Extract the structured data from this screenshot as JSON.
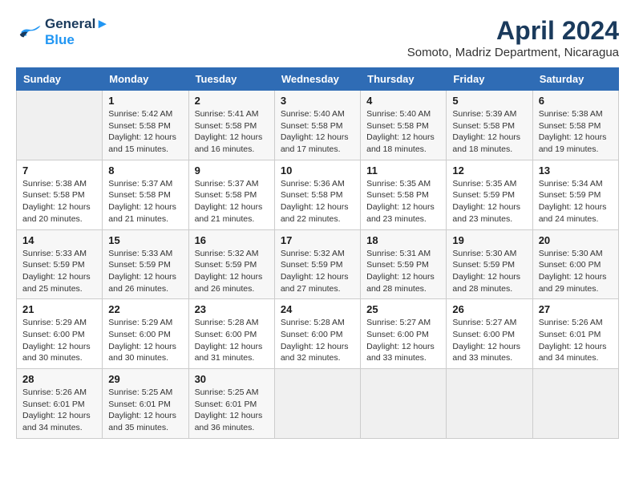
{
  "logo": {
    "line1": "General",
    "line2": "Blue"
  },
  "title": "April 2024",
  "subtitle": "Somoto, Madriz Department, Nicaragua",
  "days_header": [
    "Sunday",
    "Monday",
    "Tuesday",
    "Wednesday",
    "Thursday",
    "Friday",
    "Saturday"
  ],
  "weeks": [
    [
      {
        "num": "",
        "info": ""
      },
      {
        "num": "1",
        "info": "Sunrise: 5:42 AM\nSunset: 5:58 PM\nDaylight: 12 hours\nand 15 minutes."
      },
      {
        "num": "2",
        "info": "Sunrise: 5:41 AM\nSunset: 5:58 PM\nDaylight: 12 hours\nand 16 minutes."
      },
      {
        "num": "3",
        "info": "Sunrise: 5:40 AM\nSunset: 5:58 PM\nDaylight: 12 hours\nand 17 minutes."
      },
      {
        "num": "4",
        "info": "Sunrise: 5:40 AM\nSunset: 5:58 PM\nDaylight: 12 hours\nand 18 minutes."
      },
      {
        "num": "5",
        "info": "Sunrise: 5:39 AM\nSunset: 5:58 PM\nDaylight: 12 hours\nand 18 minutes."
      },
      {
        "num": "6",
        "info": "Sunrise: 5:38 AM\nSunset: 5:58 PM\nDaylight: 12 hours\nand 19 minutes."
      }
    ],
    [
      {
        "num": "7",
        "info": "Sunrise: 5:38 AM\nSunset: 5:58 PM\nDaylight: 12 hours\nand 20 minutes."
      },
      {
        "num": "8",
        "info": "Sunrise: 5:37 AM\nSunset: 5:58 PM\nDaylight: 12 hours\nand 21 minutes."
      },
      {
        "num": "9",
        "info": "Sunrise: 5:37 AM\nSunset: 5:58 PM\nDaylight: 12 hours\nand 21 minutes."
      },
      {
        "num": "10",
        "info": "Sunrise: 5:36 AM\nSunset: 5:58 PM\nDaylight: 12 hours\nand 22 minutes."
      },
      {
        "num": "11",
        "info": "Sunrise: 5:35 AM\nSunset: 5:58 PM\nDaylight: 12 hours\nand 23 minutes."
      },
      {
        "num": "12",
        "info": "Sunrise: 5:35 AM\nSunset: 5:59 PM\nDaylight: 12 hours\nand 23 minutes."
      },
      {
        "num": "13",
        "info": "Sunrise: 5:34 AM\nSunset: 5:59 PM\nDaylight: 12 hours\nand 24 minutes."
      }
    ],
    [
      {
        "num": "14",
        "info": "Sunrise: 5:33 AM\nSunset: 5:59 PM\nDaylight: 12 hours\nand 25 minutes."
      },
      {
        "num": "15",
        "info": "Sunrise: 5:33 AM\nSunset: 5:59 PM\nDaylight: 12 hours\nand 26 minutes."
      },
      {
        "num": "16",
        "info": "Sunrise: 5:32 AM\nSunset: 5:59 PM\nDaylight: 12 hours\nand 26 minutes."
      },
      {
        "num": "17",
        "info": "Sunrise: 5:32 AM\nSunset: 5:59 PM\nDaylight: 12 hours\nand 27 minutes."
      },
      {
        "num": "18",
        "info": "Sunrise: 5:31 AM\nSunset: 5:59 PM\nDaylight: 12 hours\nand 28 minutes."
      },
      {
        "num": "19",
        "info": "Sunrise: 5:30 AM\nSunset: 5:59 PM\nDaylight: 12 hours\nand 28 minutes."
      },
      {
        "num": "20",
        "info": "Sunrise: 5:30 AM\nSunset: 6:00 PM\nDaylight: 12 hours\nand 29 minutes."
      }
    ],
    [
      {
        "num": "21",
        "info": "Sunrise: 5:29 AM\nSunset: 6:00 PM\nDaylight: 12 hours\nand 30 minutes."
      },
      {
        "num": "22",
        "info": "Sunrise: 5:29 AM\nSunset: 6:00 PM\nDaylight: 12 hours\nand 30 minutes."
      },
      {
        "num": "23",
        "info": "Sunrise: 5:28 AM\nSunset: 6:00 PM\nDaylight: 12 hours\nand 31 minutes."
      },
      {
        "num": "24",
        "info": "Sunrise: 5:28 AM\nSunset: 6:00 PM\nDaylight: 12 hours\nand 32 minutes."
      },
      {
        "num": "25",
        "info": "Sunrise: 5:27 AM\nSunset: 6:00 PM\nDaylight: 12 hours\nand 33 minutes."
      },
      {
        "num": "26",
        "info": "Sunrise: 5:27 AM\nSunset: 6:00 PM\nDaylight: 12 hours\nand 33 minutes."
      },
      {
        "num": "27",
        "info": "Sunrise: 5:26 AM\nSunset: 6:01 PM\nDaylight: 12 hours\nand 34 minutes."
      }
    ],
    [
      {
        "num": "28",
        "info": "Sunrise: 5:26 AM\nSunset: 6:01 PM\nDaylight: 12 hours\nand 34 minutes."
      },
      {
        "num": "29",
        "info": "Sunrise: 5:25 AM\nSunset: 6:01 PM\nDaylight: 12 hours\nand 35 minutes."
      },
      {
        "num": "30",
        "info": "Sunrise: 5:25 AM\nSunset: 6:01 PM\nDaylight: 12 hours\nand 36 minutes."
      },
      {
        "num": "",
        "info": ""
      },
      {
        "num": "",
        "info": ""
      },
      {
        "num": "",
        "info": ""
      },
      {
        "num": "",
        "info": ""
      }
    ]
  ]
}
